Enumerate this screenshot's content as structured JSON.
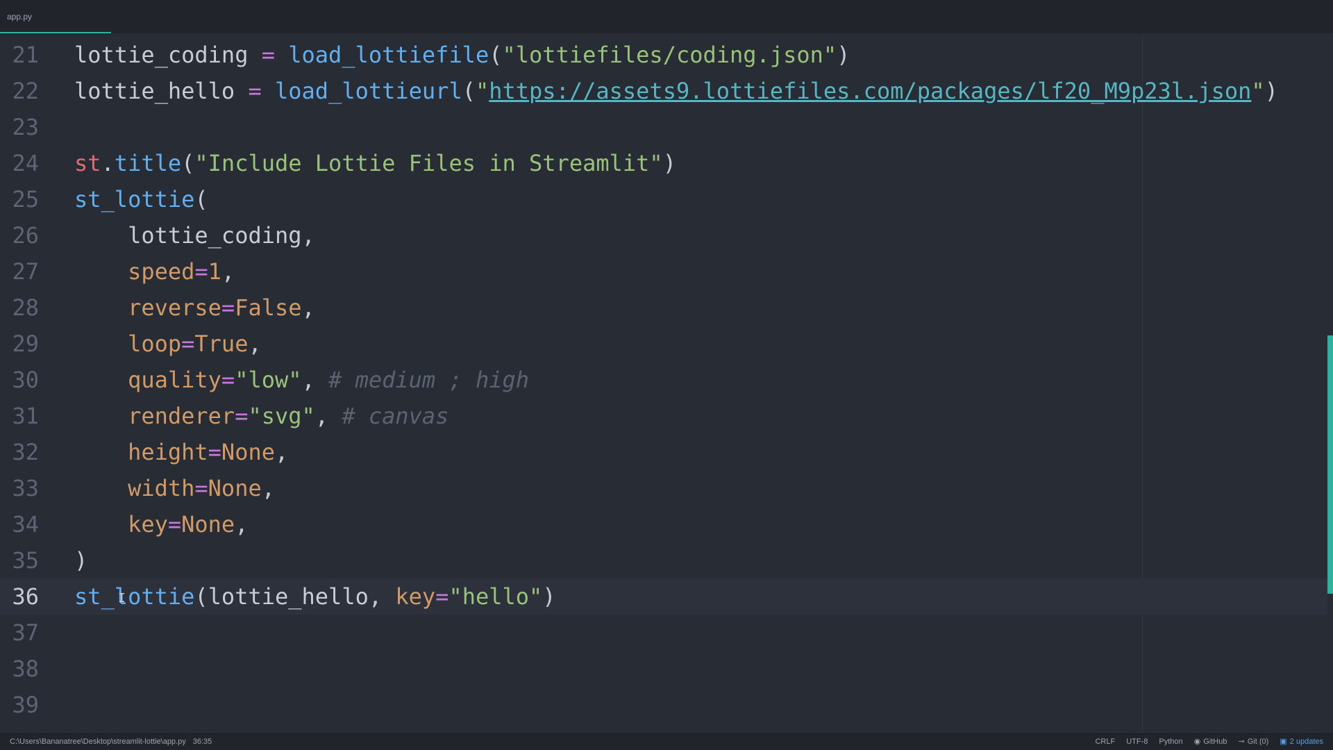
{
  "tab": {
    "label": "app.py"
  },
  "lines": [
    {
      "num": "21",
      "tokens": [
        {
          "t": "plain",
          "v": "lottie_coding "
        },
        {
          "t": "op",
          "v": "="
        },
        {
          "t": "plain",
          "v": " "
        },
        {
          "t": "fn",
          "v": "load_lottiefile"
        },
        {
          "t": "plain",
          "v": "("
        },
        {
          "t": "str",
          "v": "\"lottiefiles/coding.json\""
        },
        {
          "t": "plain",
          "v": ")"
        }
      ]
    },
    {
      "num": "22",
      "tokens": [
        {
          "t": "plain",
          "v": "lottie_hello "
        },
        {
          "t": "op",
          "v": "="
        },
        {
          "t": "plain",
          "v": " "
        },
        {
          "t": "fn",
          "v": "load_lottieurl"
        },
        {
          "t": "plain",
          "v": "("
        },
        {
          "t": "str",
          "v": "\""
        },
        {
          "t": "url",
          "v": "https://assets9.lottiefiles.com/packages/lf20_M9p23l.json"
        },
        {
          "t": "str",
          "v": "\""
        },
        {
          "t": "plain",
          "v": ")"
        }
      ]
    },
    {
      "num": "23",
      "tokens": []
    },
    {
      "num": "24",
      "tokens": [
        {
          "t": "obj",
          "v": "st"
        },
        {
          "t": "plain",
          "v": "."
        },
        {
          "t": "fn",
          "v": "title"
        },
        {
          "t": "plain",
          "v": "("
        },
        {
          "t": "str",
          "v": "\"Include Lottie Files in Streamlit\""
        },
        {
          "t": "plain",
          "v": ")"
        }
      ]
    },
    {
      "num": "25",
      "tokens": [
        {
          "t": "fn",
          "v": "st_lottie"
        },
        {
          "t": "plain",
          "v": "("
        }
      ]
    },
    {
      "num": "26",
      "tokens": [
        {
          "t": "plain",
          "v": "    lottie_coding,"
        }
      ]
    },
    {
      "num": "27",
      "tokens": [
        {
          "t": "plain",
          "v": "    "
        },
        {
          "t": "param",
          "v": "speed"
        },
        {
          "t": "op",
          "v": "="
        },
        {
          "t": "num",
          "v": "1"
        },
        {
          "t": "plain",
          "v": ","
        }
      ]
    },
    {
      "num": "28",
      "tokens": [
        {
          "t": "plain",
          "v": "    "
        },
        {
          "t": "param",
          "v": "reverse"
        },
        {
          "t": "op",
          "v": "="
        },
        {
          "t": "const",
          "v": "False"
        },
        {
          "t": "plain",
          "v": ","
        }
      ]
    },
    {
      "num": "29",
      "tokens": [
        {
          "t": "plain",
          "v": "    "
        },
        {
          "t": "param",
          "v": "loop"
        },
        {
          "t": "op",
          "v": "="
        },
        {
          "t": "const",
          "v": "True"
        },
        {
          "t": "plain",
          "v": ","
        }
      ]
    },
    {
      "num": "30",
      "tokens": [
        {
          "t": "plain",
          "v": "    "
        },
        {
          "t": "param",
          "v": "quality"
        },
        {
          "t": "op",
          "v": "="
        },
        {
          "t": "str",
          "v": "\"low\""
        },
        {
          "t": "plain",
          "v": ", "
        },
        {
          "t": "comment",
          "v": "# medium ; high"
        }
      ]
    },
    {
      "num": "31",
      "tokens": [
        {
          "t": "plain",
          "v": "    "
        },
        {
          "t": "param",
          "v": "renderer"
        },
        {
          "t": "op",
          "v": "="
        },
        {
          "t": "str",
          "v": "\"svg\""
        },
        {
          "t": "plain",
          "v": ", "
        },
        {
          "t": "comment",
          "v": "# canvas"
        }
      ]
    },
    {
      "num": "32",
      "tokens": [
        {
          "t": "plain",
          "v": "    "
        },
        {
          "t": "param",
          "v": "height"
        },
        {
          "t": "op",
          "v": "="
        },
        {
          "t": "const",
          "v": "None"
        },
        {
          "t": "plain",
          "v": ","
        }
      ]
    },
    {
      "num": "33",
      "tokens": [
        {
          "t": "plain",
          "v": "    "
        },
        {
          "t": "param",
          "v": "width"
        },
        {
          "t": "op",
          "v": "="
        },
        {
          "t": "const",
          "v": "None"
        },
        {
          "t": "plain",
          "v": ","
        }
      ]
    },
    {
      "num": "34",
      "tokens": [
        {
          "t": "plain",
          "v": "    "
        },
        {
          "t": "param",
          "v": "key"
        },
        {
          "t": "op",
          "v": "="
        },
        {
          "t": "const",
          "v": "None"
        },
        {
          "t": "plain",
          "v": ","
        }
      ]
    },
    {
      "num": "35",
      "tokens": [
        {
          "t": "plain",
          "v": ")"
        }
      ]
    },
    {
      "num": "36",
      "active": true,
      "tokens": [
        {
          "t": "fn",
          "v": "st_lottie"
        },
        {
          "t": "plain",
          "v": "(lottie_hello, "
        },
        {
          "t": "param",
          "v": "key"
        },
        {
          "t": "op",
          "v": "="
        },
        {
          "t": "str",
          "v": "\"hello\""
        },
        {
          "t": "plain",
          "v": ")"
        }
      ]
    },
    {
      "num": "37",
      "tokens": []
    },
    {
      "num": "38",
      "tokens": []
    },
    {
      "num": "39",
      "tokens": []
    }
  ],
  "status": {
    "path": "C:\\Users\\Bananatree\\Desktop\\streamlit-lottie\\app.py",
    "cursor_pos": "36:35",
    "line_ending": "CRLF",
    "encoding": "UTF-8",
    "grammar": "Python",
    "github": "GitHub",
    "git": "Git (0)",
    "updates": "2 updates"
  },
  "icons": {
    "github": "github-icon",
    "git": "git-branch-icon",
    "updates": "package-icon"
  },
  "colors": {
    "background": "#282c34",
    "accent": "#2bb3a0",
    "function": "#61afef",
    "string": "#98c379",
    "keyword": "#c678dd",
    "parameter": "#d19a66",
    "object": "#e06c75",
    "comment": "#5c6370"
  }
}
